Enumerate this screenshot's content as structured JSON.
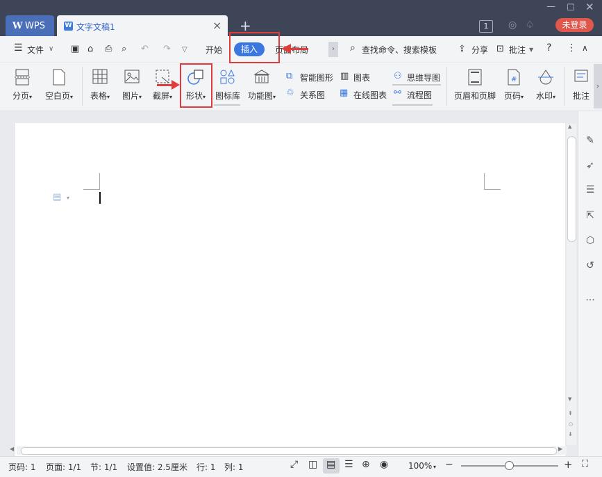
{
  "titlebar": {
    "app_tab": "WPS",
    "doc_tab": "文字文稿1",
    "doc_tab_icon": "W",
    "new_tab": "+",
    "badge": "1",
    "login": "未登录"
  },
  "menu": {
    "file": "文件",
    "start": "开始",
    "insert": "插入",
    "page_layout": "页面布局",
    "search": "查找命令、搜索模板",
    "share": "分享",
    "comment": "批注",
    "help": "?"
  },
  "ribbon": {
    "page_break": "分页",
    "blank_page": "空白页",
    "table": "表格",
    "picture": "图片",
    "screenshot": "截屏",
    "shape": "形状",
    "icon_lib": "图标库",
    "func_chart": "功能图",
    "smart_art": "智能图形",
    "chart": "图表",
    "mind_map": "思维导图",
    "relation": "关系图",
    "online_chart": "在线图表",
    "flowchart": "流程图",
    "header_footer": "页眉和页脚",
    "page_num": "页码",
    "watermark": "水印",
    "annotation": "批注"
  },
  "statusbar": {
    "page_code": "页码: 1",
    "pages": "页面: 1/1",
    "section": "节: 1/1",
    "setting": "设置值: 2.5厘米",
    "row": "行: 1",
    "col": "列: 1",
    "zoom": "100%"
  },
  "colors": {
    "accent": "#3a78e0",
    "highlight_box": "#e03c3c",
    "titlebar_bg": "#3d4556",
    "login_bg": "#e2574c"
  }
}
